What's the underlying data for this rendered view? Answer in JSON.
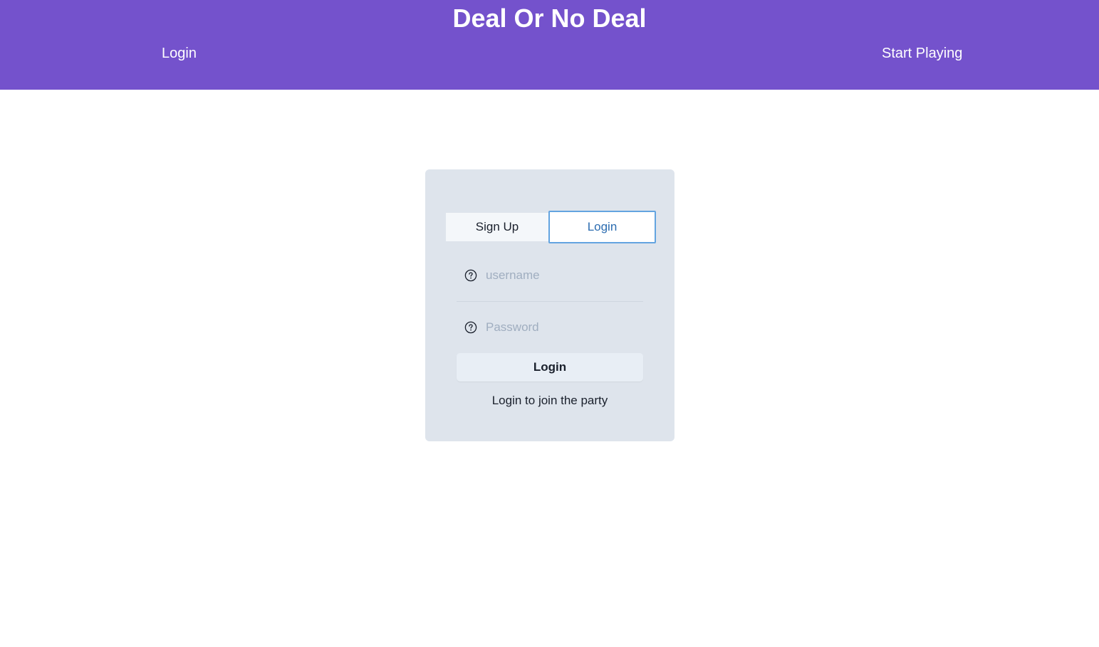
{
  "header": {
    "title": "Deal Or No Deal",
    "nav": {
      "login": "Login",
      "start_playing": "Start Playing"
    },
    "background_color": "#7452cc"
  },
  "auth_card": {
    "tabs": [
      {
        "label": "Sign Up",
        "active": false
      },
      {
        "label": "Login",
        "active": true
      }
    ],
    "username": {
      "placeholder": "username",
      "value": "",
      "icon": "help-circle-icon"
    },
    "password": {
      "placeholder": "Password",
      "value": "",
      "icon": "help-circle-icon"
    },
    "submit_label": "Login",
    "hint": "Login to join the party"
  },
  "colors": {
    "accent": "#7452cc",
    "card_background": "#dee4ec",
    "active_tab_border": "#63a4e0",
    "active_tab_text": "#2b6cb0"
  }
}
